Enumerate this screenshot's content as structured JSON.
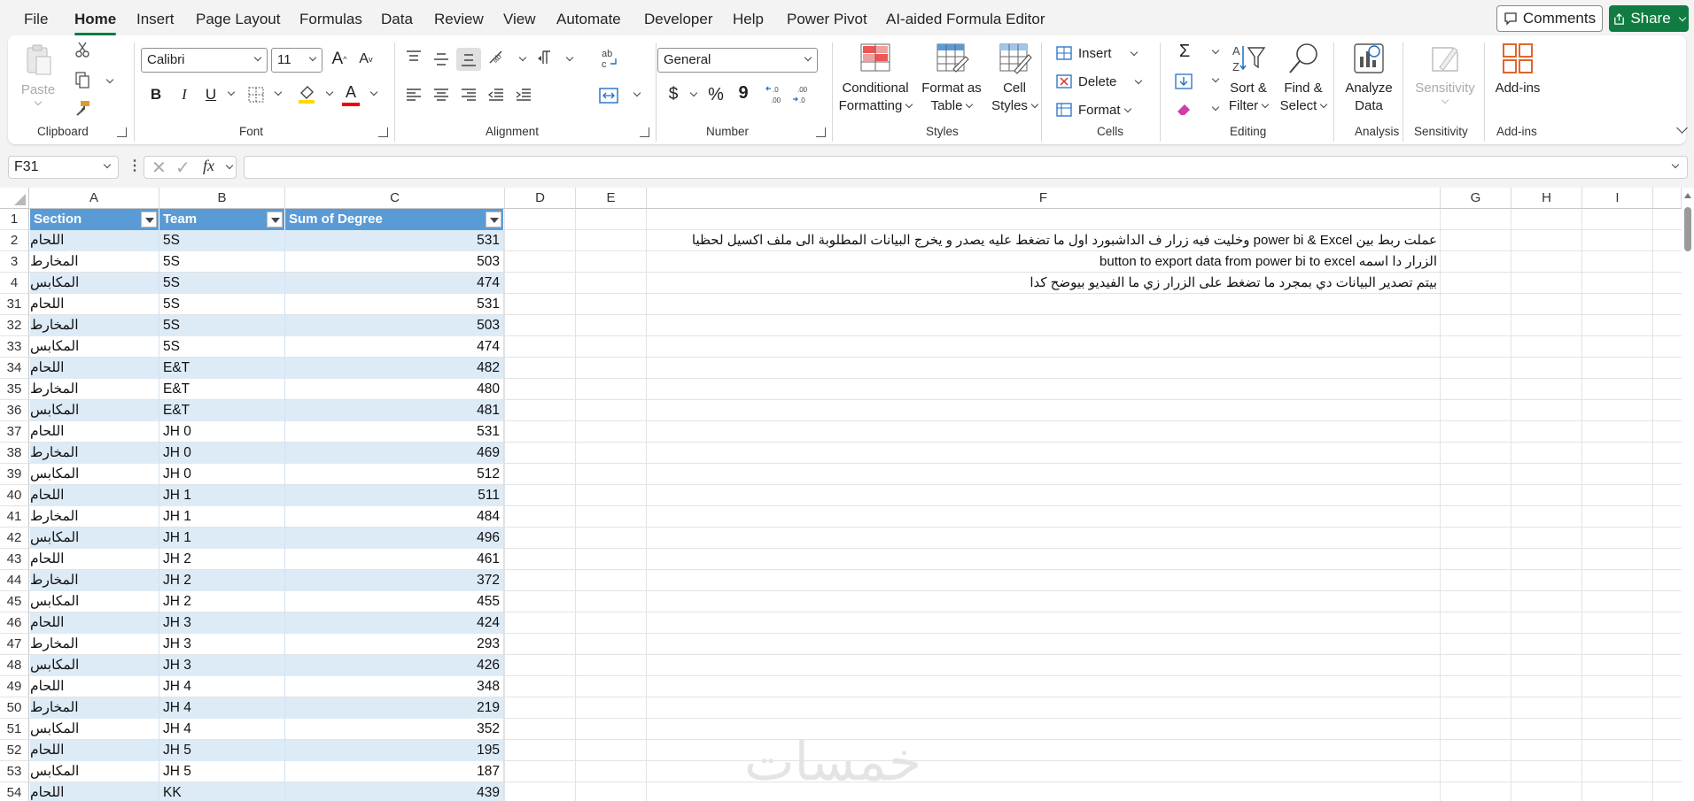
{
  "menu": {
    "items": [
      "File",
      "Home",
      "Insert",
      "Page Layout",
      "Formulas",
      "Data",
      "Review",
      "View",
      "Automate",
      "Developer",
      "Help",
      "Power Pivot",
      "AI-aided Formula Editor"
    ],
    "active": "Home",
    "comments_label": "Comments",
    "share_label": "Share"
  },
  "ribbon": {
    "clipboard": {
      "label": "Clipboard",
      "paste_label": "Paste"
    },
    "font": {
      "label": "Font",
      "font_name": "Calibri",
      "font_size": "11",
      "bold": "B",
      "italic": "I",
      "underline": "U",
      "font_color_letter": "A"
    },
    "alignment": {
      "label": "Alignment"
    },
    "number": {
      "label": "Number",
      "format": "General",
      "currency": "$",
      "percent": "%",
      "comma": "9"
    },
    "styles": {
      "label": "Styles",
      "conditional": [
        "Conditional",
        "Formatting"
      ],
      "format_table": [
        "Format as",
        "Table"
      ],
      "cell_styles": [
        "Cell",
        "Styles"
      ]
    },
    "cells": {
      "label": "Cells",
      "insert": "Insert",
      "delete": "Delete",
      "format": "Format"
    },
    "editing": {
      "label": "Editing",
      "sort": [
        "Sort &",
        "Filter"
      ],
      "find": [
        "Find &",
        "Select"
      ]
    },
    "analysis": {
      "label": "Analysis",
      "analyze": [
        "Analyze",
        "Data"
      ]
    },
    "sensitivity": {
      "label": "Sensitivity",
      "btn": "Sensitivity"
    },
    "addins": {
      "label": "Add-ins",
      "btn": "Add-ins"
    }
  },
  "formula_bar": {
    "name_box": "F31",
    "fx": "fx",
    "value": ""
  },
  "columns": [
    "A",
    "B",
    "C",
    "D",
    "E",
    "F",
    "G",
    "H",
    "I"
  ],
  "rows": [
    "1",
    "2",
    "3",
    "4",
    "31",
    "32",
    "33",
    "34",
    "35",
    "36",
    "37",
    "38",
    "39",
    "40",
    "41",
    "42",
    "43",
    "44",
    "45",
    "46",
    "47",
    "48",
    "49",
    "50",
    "51",
    "52",
    "53",
    "54"
  ],
  "table": {
    "headers": [
      "Section",
      "Team",
      "Sum of Degree"
    ],
    "rows": [
      [
        "اللحام",
        "5S",
        "531"
      ],
      [
        "المخارط",
        "5S",
        "503"
      ],
      [
        "المكابس",
        "5S",
        "474"
      ],
      [
        "اللحام",
        "5S",
        "531"
      ],
      [
        "المخارط",
        "5S",
        "503"
      ],
      [
        "المكابس",
        "5S",
        "474"
      ],
      [
        "اللحام",
        "E&T",
        "482"
      ],
      [
        "المخارط",
        "E&T",
        "480"
      ],
      [
        "المكابس",
        "E&T",
        "481"
      ],
      [
        "اللحام",
        "JH 0",
        "531"
      ],
      [
        "المخارط",
        "JH 0",
        "469"
      ],
      [
        "المكابس",
        "JH 0",
        "512"
      ],
      [
        "اللحام",
        "JH 1",
        "511"
      ],
      [
        "المخارط",
        "JH 1",
        "484"
      ],
      [
        "المكابس",
        "JH 1",
        "496"
      ],
      [
        "اللحام",
        "JH 2",
        "461"
      ],
      [
        "المخارط",
        "JH 2",
        "372"
      ],
      [
        "المكابس",
        "JH 2",
        "455"
      ],
      [
        "اللحام",
        "JH 3",
        "424"
      ],
      [
        "المخارط",
        "JH 3",
        "293"
      ],
      [
        "المكابس",
        "JH 3",
        "426"
      ],
      [
        "اللحام",
        "JH 4",
        "348"
      ],
      [
        "المخارط",
        "JH 4",
        "219"
      ],
      [
        "المكابس",
        "JH 4",
        "352"
      ],
      [
        "اللحام",
        "JH 5",
        "195"
      ],
      [
        "المكابس",
        "JH 5",
        "187"
      ],
      [
        "اللحام",
        "KK",
        "439"
      ]
    ]
  },
  "notes": [
    "عملت ربط بين  power bi & Excel  وخليت فيه زرار ف الداشبورد اول ما تضغط عليه يصدر و يخرج البيانات المطلوبة الى ملف اكسيل لحظيا",
    "الزرار دا اسمه button to export data from power bi to excel",
    "بيتم تصدير البيانات دي بمجرد ما تضغط على الزرار زي ما الفيديو بيوضح كدا"
  ],
  "watermark": "خمسات",
  "colors": {
    "accent": "#107c41",
    "table_header": "#5b9bd5",
    "table_band": "#ddebf7"
  }
}
